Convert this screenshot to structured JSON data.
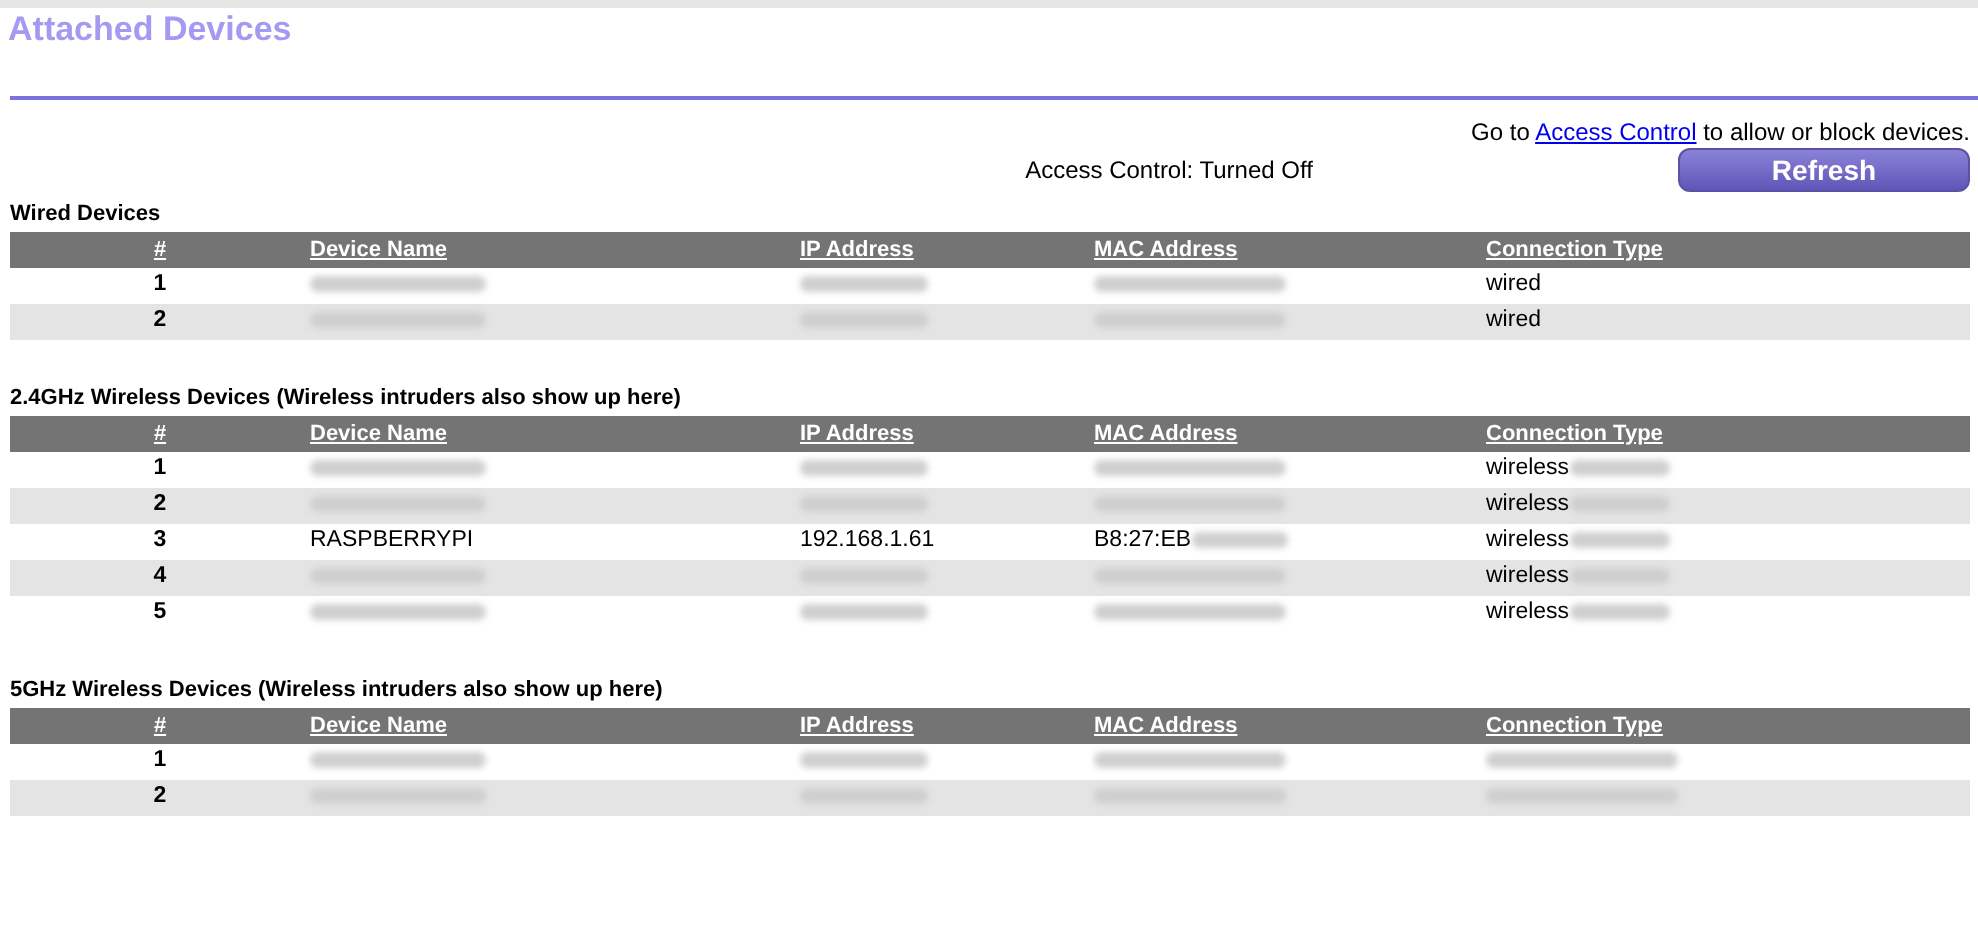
{
  "title": "Attached Devices",
  "access_note": {
    "before": "Go to ",
    "link": "Access Control",
    "after": " to allow or block devices."
  },
  "access_status": "Access Control: Turned Off",
  "refresh_button": "Refresh",
  "sections": [
    {
      "heading": "Wired Devices",
      "columns": [
        "#",
        "Device Name",
        "IP Address",
        "MAC Address",
        "Connection Type"
      ],
      "rows": [
        [
          [
            {
              "kind": "text",
              "text": "1"
            }
          ],
          [
            {
              "kind": "redacted"
            }
          ],
          [
            {
              "kind": "redacted"
            }
          ],
          [
            {
              "kind": "redacted"
            }
          ],
          [
            {
              "kind": "text",
              "text": "wired"
            }
          ]
        ],
        [
          [
            {
              "kind": "text",
              "text": "2"
            }
          ],
          [
            {
              "kind": "redacted"
            }
          ],
          [
            {
              "kind": "redacted"
            }
          ],
          [
            {
              "kind": "redacted"
            }
          ],
          [
            {
              "kind": "text",
              "text": "wired"
            }
          ]
        ]
      ]
    },
    {
      "heading": "2.4GHz Wireless Devices (Wireless intruders also show up here)",
      "columns": [
        "#",
        "Device Name",
        "IP Address",
        "MAC Address",
        "Connection Type"
      ],
      "rows": [
        [
          [
            {
              "kind": "text",
              "text": "1"
            }
          ],
          [
            {
              "kind": "redacted"
            }
          ],
          [
            {
              "kind": "redacted"
            }
          ],
          [
            {
              "kind": "redacted"
            }
          ],
          [
            {
              "kind": "text",
              "text": "wireless"
            },
            {
              "kind": "redacted"
            }
          ]
        ],
        [
          [
            {
              "kind": "text",
              "text": "2"
            }
          ],
          [
            {
              "kind": "redacted"
            }
          ],
          [
            {
              "kind": "redacted"
            }
          ],
          [
            {
              "kind": "redacted"
            }
          ],
          [
            {
              "kind": "text",
              "text": "wireless"
            },
            {
              "kind": "redacted"
            }
          ]
        ],
        [
          [
            {
              "kind": "text",
              "text": "3"
            }
          ],
          [
            {
              "kind": "text",
              "text": "RASPBERRYPI"
            }
          ],
          [
            {
              "kind": "text",
              "text": "192.168.1.61"
            }
          ],
          [
            {
              "kind": "text",
              "text": "B8:27:EB"
            },
            {
              "kind": "redacted"
            }
          ],
          [
            {
              "kind": "text",
              "text": "wireless"
            },
            {
              "kind": "redacted"
            }
          ]
        ],
        [
          [
            {
              "kind": "text",
              "text": "4"
            }
          ],
          [
            {
              "kind": "redacted"
            }
          ],
          [
            {
              "kind": "redacted"
            }
          ],
          [
            {
              "kind": "redacted"
            }
          ],
          [
            {
              "kind": "text",
              "text": "wireless"
            },
            {
              "kind": "redacted"
            }
          ]
        ],
        [
          [
            {
              "kind": "text",
              "text": "5"
            }
          ],
          [
            {
              "kind": "redacted"
            }
          ],
          [
            {
              "kind": "redacted"
            }
          ],
          [
            {
              "kind": "redacted"
            }
          ],
          [
            {
              "kind": "text",
              "text": "wireless"
            },
            {
              "kind": "redacted"
            }
          ]
        ]
      ]
    },
    {
      "heading": "5GHz Wireless Devices (Wireless intruders also show up here)",
      "columns": [
        "#",
        "Device Name",
        "IP Address",
        "MAC Address",
        "Connection Type"
      ],
      "rows": [
        [
          [
            {
              "kind": "text",
              "text": "1"
            }
          ],
          [
            {
              "kind": "redacted"
            }
          ],
          [
            {
              "kind": "redacted"
            }
          ],
          [
            {
              "kind": "redacted"
            }
          ],
          [
            {
              "kind": "redacted"
            }
          ]
        ],
        [
          [
            {
              "kind": "text",
              "text": "2"
            }
          ],
          [
            {
              "kind": "redacted"
            }
          ],
          [
            {
              "kind": "redacted"
            }
          ],
          [
            {
              "kind": "redacted"
            }
          ],
          [
            {
              "kind": "redacted"
            }
          ]
        ]
      ]
    }
  ]
}
